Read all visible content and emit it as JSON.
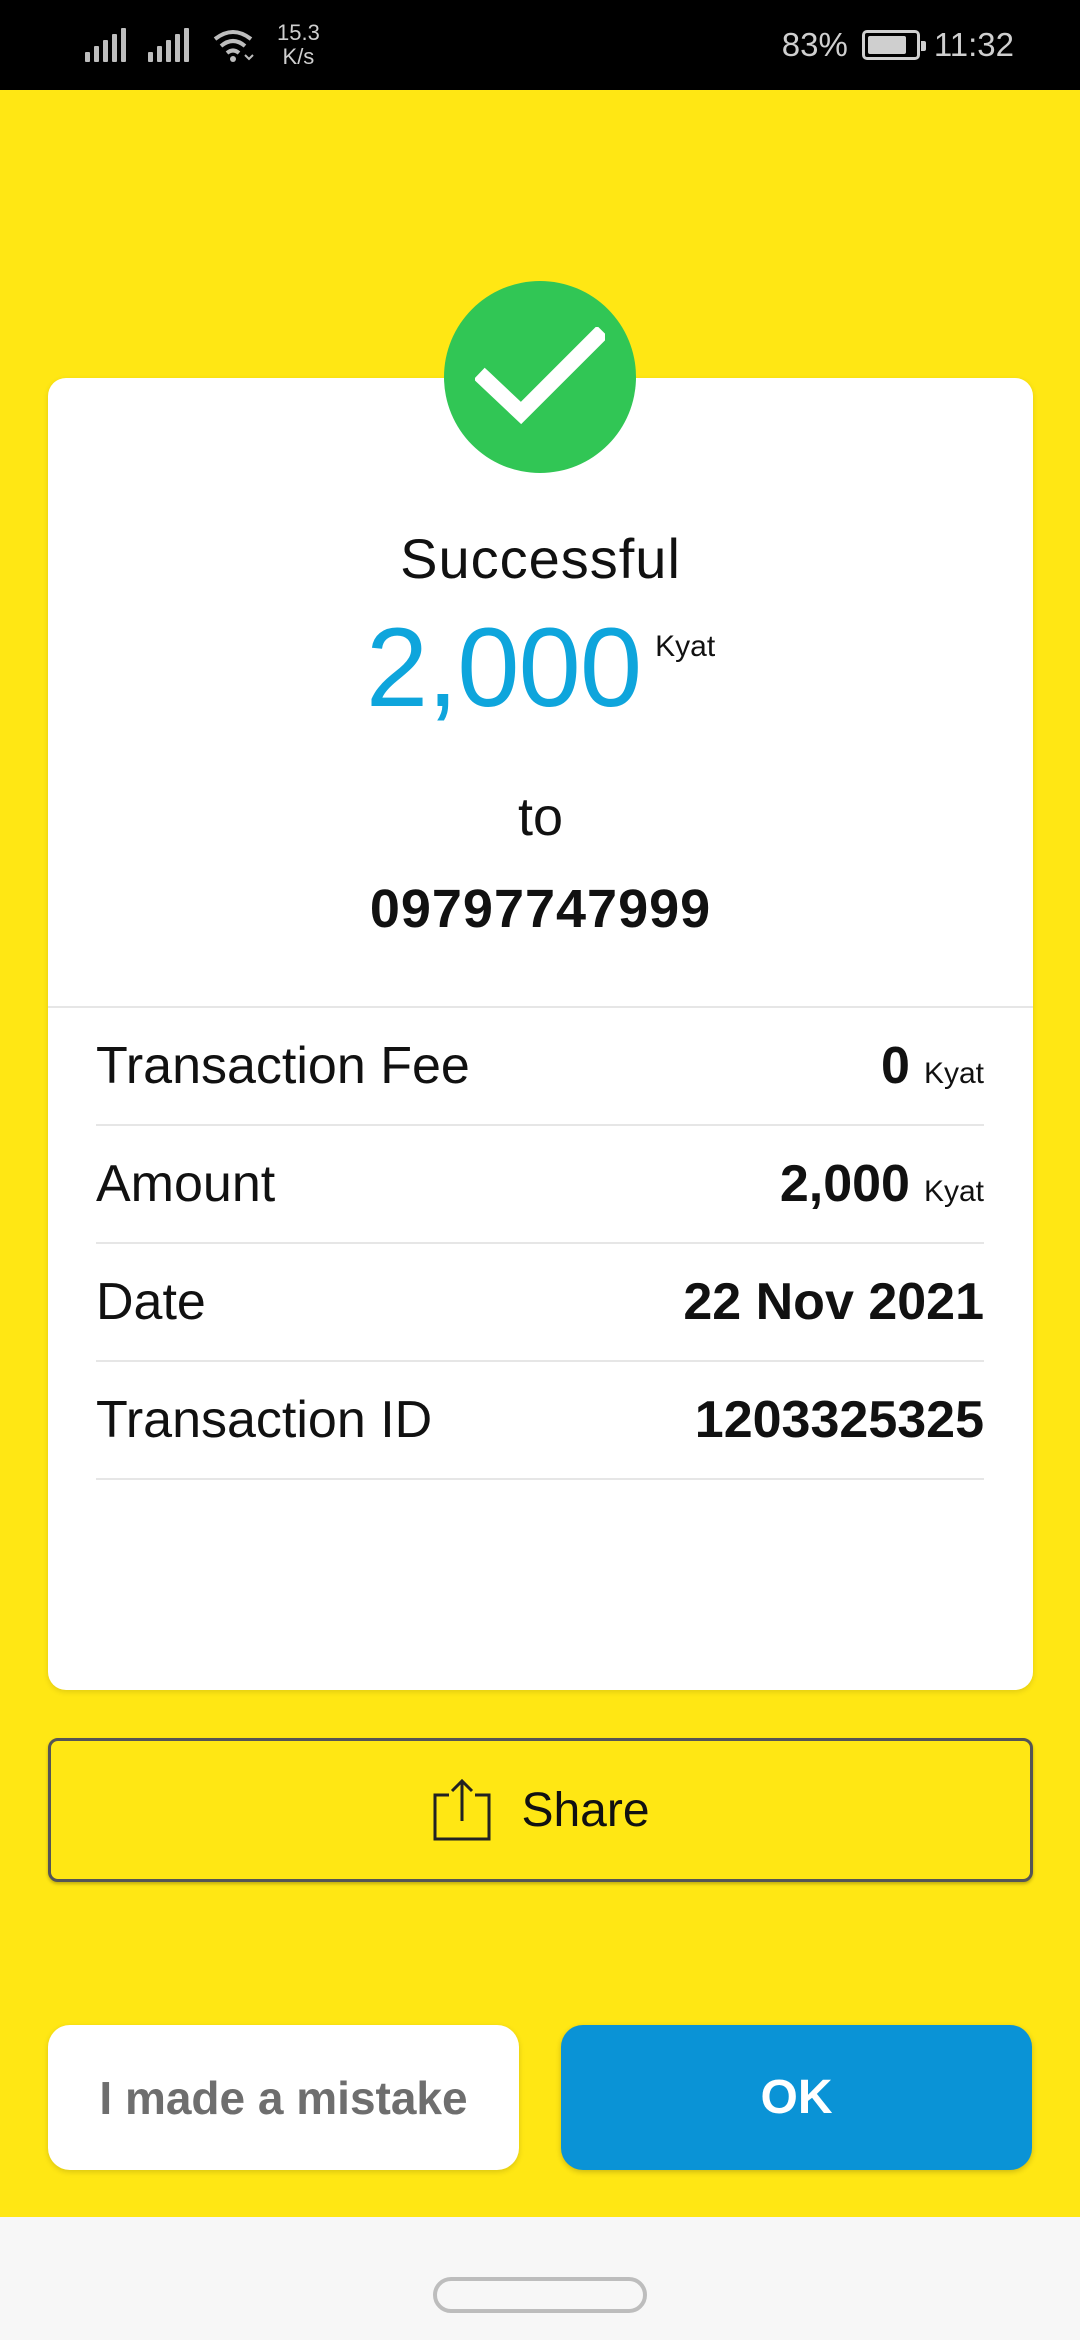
{
  "status_bar": {
    "network_speed_value": "15.3",
    "network_speed_unit": "K/s",
    "battery_percent": "83%",
    "battery_level": 0.83,
    "time": "11:32"
  },
  "receipt": {
    "status_title": "Successful",
    "amount": "2,000",
    "amount_unit": "Kyat",
    "to_label": "to",
    "recipient": "09797747999",
    "details": [
      {
        "label": "Transaction Fee",
        "value": "0",
        "unit": "Kyat"
      },
      {
        "label": "Amount",
        "value": "2,000",
        "unit": "Kyat"
      },
      {
        "label": "Date",
        "value": "22 Nov 2021"
      },
      {
        "label": "Transaction ID",
        "value": "1203325325"
      }
    ]
  },
  "actions": {
    "share_label": "Share",
    "mistake_label": "I made a mistake",
    "ok_label": "OK"
  },
  "colors": {
    "background": "#ffe714",
    "success_green": "#31c655",
    "amount_blue": "#0ea5dc",
    "ok_button": "#0a93d6"
  }
}
